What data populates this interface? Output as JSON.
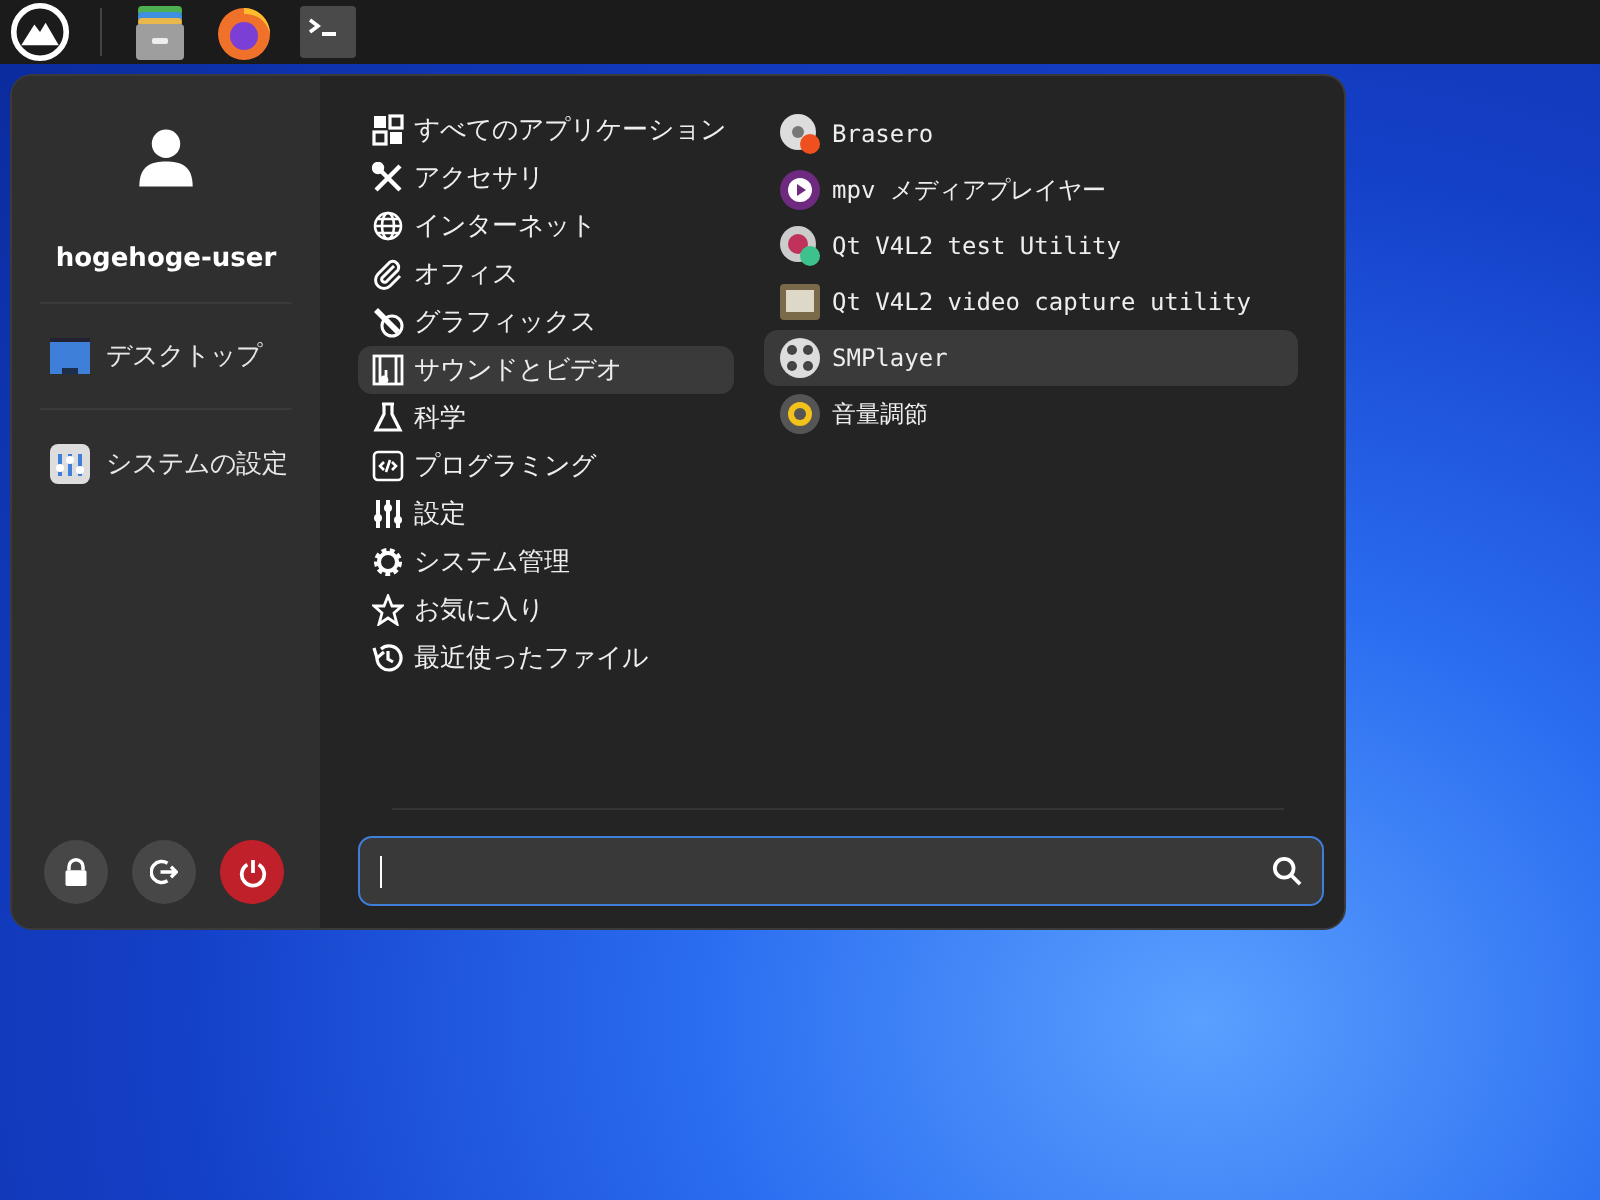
{
  "user": {
    "name": "hogehoge-user"
  },
  "places": [
    {
      "label": "デスクトップ"
    },
    {
      "label": "システムの設定"
    }
  ],
  "categories": [
    {
      "label": "すべてのアプリケーション",
      "selected": false
    },
    {
      "label": "アクセサリ",
      "selected": false
    },
    {
      "label": "インターネット",
      "selected": false
    },
    {
      "label": "オフィス",
      "selected": false
    },
    {
      "label": "グラフィックス",
      "selected": false
    },
    {
      "label": "サウンドとビデオ",
      "selected": true
    },
    {
      "label": "科学",
      "selected": false
    },
    {
      "label": "プログラミング",
      "selected": false
    },
    {
      "label": "設定",
      "selected": false
    },
    {
      "label": "システム管理",
      "selected": false
    },
    {
      "label": "お気に入り",
      "selected": false
    },
    {
      "label": "最近使ったファイル",
      "selected": false
    }
  ],
  "apps": [
    {
      "label": "Brasero",
      "selected": false
    },
    {
      "label": "mpv メディアプレイヤー",
      "selected": false
    },
    {
      "label": "Qt V4L2 test Utility",
      "selected": false
    },
    {
      "label": "Qt V4L2 video capture utility",
      "selected": false
    },
    {
      "label": "SMPlayer",
      "selected": true
    },
    {
      "label": "音量調節",
      "selected": false
    }
  ],
  "search": {
    "focused": true
  }
}
